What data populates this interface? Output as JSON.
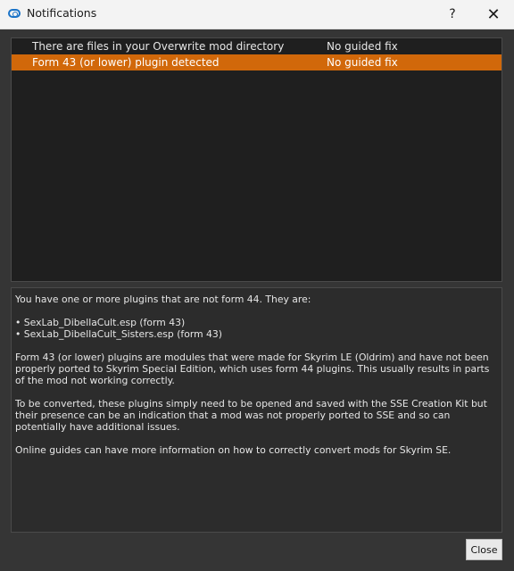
{
  "window": {
    "title": "Notifications",
    "help_glyph": "?",
    "close_glyph": "✕",
    "icon": "app-logo-icon"
  },
  "notifications": [
    {
      "message": "There are files in your Overwrite mod directory",
      "fix": "No guided fix",
      "selected": false
    },
    {
      "message": "Form 43 (or lower) plugin detected",
      "fix": "No guided fix",
      "selected": true
    }
  ],
  "details": {
    "intro": "You have one or more plugins that are not form 44. They are:",
    "plugins": [
      "• SexLab_DibellaCult.esp (form 43)",
      "• SexLab_DibellaCult_Sisters.esp (form 43)"
    ],
    "para1": "Form 43 (or lower) plugins are modules that were made for Skyrim LE (Oldrim) and have not been properly ported to Skyrim Special Edition, which uses form 44 plugins. This usually results in parts of the mod not working correctly.",
    "para2": "To be converted, these plugins simply need to be opened and saved with the SSE Creation Kit but their presence can be an indication that a mod was not properly ported to SSE and so can potentially have additional issues.",
    "para3": "Online guides can have more information on how to correctly convert mods for Skyrim SE."
  },
  "buttons": {
    "close_label": "Close"
  },
  "colors": {
    "selection": "#d1680a",
    "background": "#353535"
  }
}
